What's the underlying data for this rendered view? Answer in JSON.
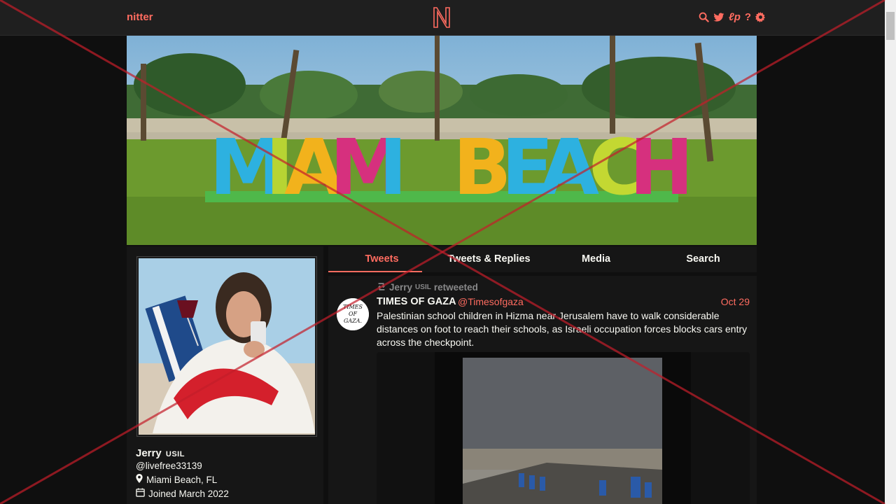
{
  "nav": {
    "brand": "nitter",
    "logo_letter": "N",
    "icons": [
      "search-icon",
      "twitter-bird-icon",
      "rss-icon",
      "help-icon",
      "settings-gear-icon"
    ],
    "icon_rss_text": "ℓp",
    "icon_help_text": "?"
  },
  "banner": {
    "sign_text": "MIAMI BEACH"
  },
  "profile": {
    "fullname": "Jerry",
    "verified_label": "USIL",
    "username": "@livefree33139",
    "location": "Miami Beach, FL",
    "joined": "Joined March 2022"
  },
  "tabs": [
    {
      "label": "Tweets",
      "active": true
    },
    {
      "label": "Tweets & Replies",
      "active": false
    },
    {
      "label": "Media",
      "active": false
    },
    {
      "label": "Search",
      "active": false
    }
  ],
  "tweet": {
    "retweet_by": "Jerry",
    "retweet_verified": "USIL",
    "retweet_suffix": "retweeted",
    "fullname": "TIMES OF GAZA",
    "username": "@Timesofgaza",
    "date": "Oct 29",
    "text": "Palestinian school children in Hizma near Jerusalem have to walk considerable distances on foot to reach their schools, as Israeli occupation forces blocks cars entry across the checkpoint.",
    "avatar_text": [
      "TIMES",
      "OF",
      "GAZA."
    ]
  },
  "colors": {
    "accent": "#ff6c60",
    "background": "#0f0f0f",
    "panel": "#161616",
    "navbar": "#1f1f1f",
    "muted": "#888889"
  }
}
